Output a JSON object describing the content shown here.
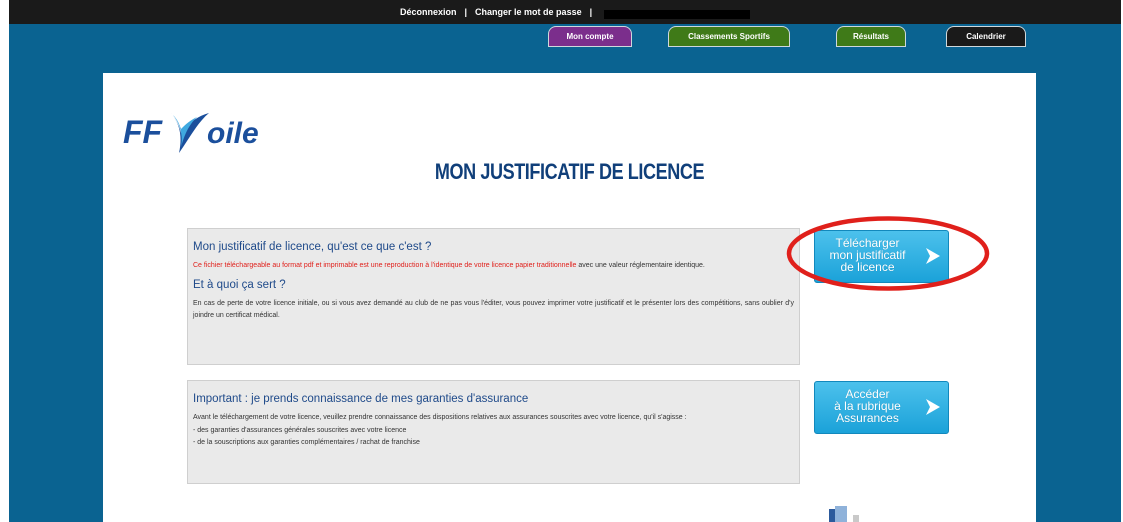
{
  "topbar": {
    "logout": "Déconnexion",
    "separator1": "|",
    "change_password": "Changer le mot de passe",
    "separator2": "|"
  },
  "tabs": [
    {
      "label": "Mon compte",
      "color": "#7b2e8c"
    },
    {
      "label": "Classements Sportifs",
      "color": "#3f7a18"
    },
    {
      "label": "Résultats",
      "color": "#3f7a18"
    },
    {
      "label": "Calendrier",
      "color": "#1a1a1a"
    }
  ],
  "logo": {
    "text": "FF Voile"
  },
  "page": {
    "title": "MON JUSTIFICATIF DE LICENCE"
  },
  "info_box": {
    "heading1": "Mon justificatif de licence, qu'est ce que c'est ?",
    "para1_red": "Ce fichier téléchargeable au format pdf et imprimable est une reproduction à l'identique de votre licence papier traditionnelle",
    "para1_rest": " avec une valeur réglementaire identique.",
    "heading2": "Et à quoi ça sert ?",
    "para2": "En cas de perte de votre licence initiale, ou si vous avez demandé au club de ne pas vous l'éditer, vous pouvez imprimer votre justificatif et le présenter lors des compétitions, sans oublier d'y joindre un certificat médical."
  },
  "insurance_box": {
    "heading": "Important : je prends connaissance de mes garanties d'assurance",
    "para": "Avant le téléchargement de votre licence, veuillez prendre connaissance des dispositions relatives aux assurances souscrites avec votre licence, qu'il s'agisse :",
    "bullet1": "- des garanties d'assurances générales souscrites avec votre licence",
    "bullet2": "- de la souscriptions aux garanties complémentaires / rachat de franchise"
  },
  "buttons": {
    "download": [
      "Télécharger",
      "mon justificatif",
      "de licence"
    ],
    "insurance": [
      "Accéder",
      "à la rubrique",
      "Assurances"
    ]
  },
  "colors": {
    "background": "#0a6391",
    "title": "#103f7a",
    "button": "#1ba2d9",
    "annotation_circle": "#e0201b"
  }
}
